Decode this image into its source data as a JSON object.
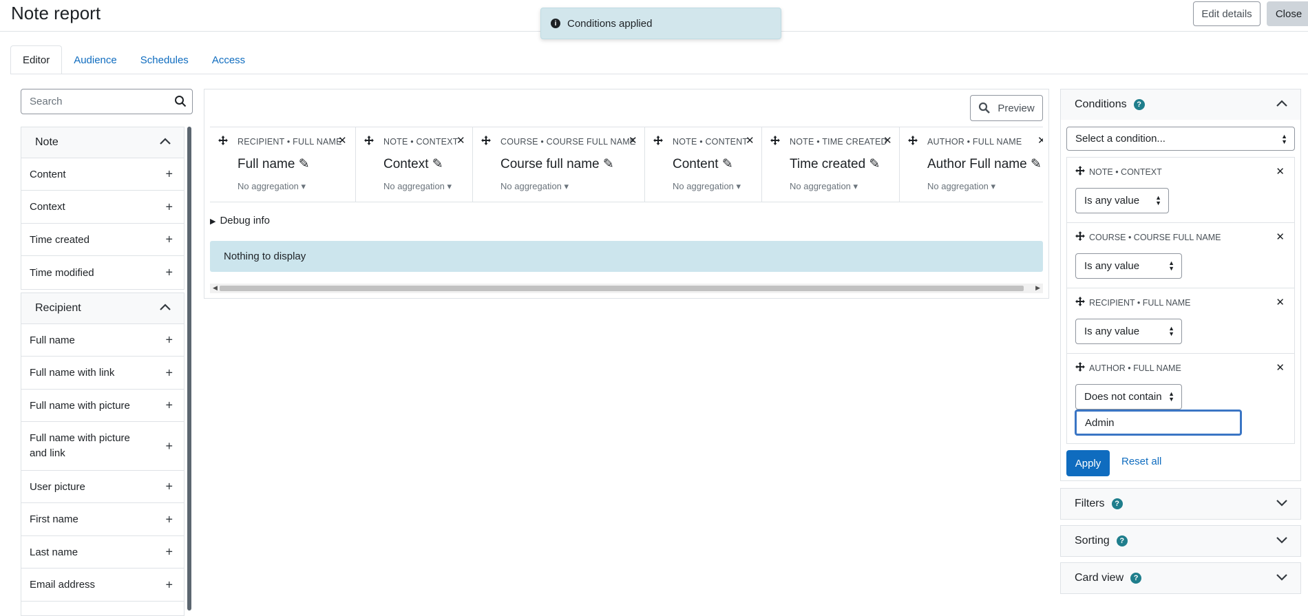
{
  "header": {
    "title": "Note report",
    "edit_details": "Edit details",
    "close": "Close"
  },
  "toast": {
    "message": "Conditions applied"
  },
  "tabs": [
    {
      "label": "Editor"
    },
    {
      "label": "Audience"
    },
    {
      "label": "Schedules"
    },
    {
      "label": "Access"
    }
  ],
  "sidebar": {
    "search_placeholder": "Search",
    "groups": [
      {
        "title": "Note",
        "items": [
          "Content",
          "Context",
          "Time created",
          "Time modified"
        ]
      },
      {
        "title": "Recipient",
        "items": [
          "Full name",
          "Full name with link",
          "Full name with picture",
          "Full name with picture and link",
          "User picture",
          "First name",
          "Last name",
          "Email address"
        ]
      }
    ]
  },
  "editor": {
    "preview_label": "Preview",
    "columns": [
      {
        "caption": "RECIPIENT • FULL NAME",
        "title": "Full name",
        "aggregation": "No aggregation"
      },
      {
        "caption": "NOTE • CONTEXT",
        "title": "Context",
        "aggregation": "No aggregation"
      },
      {
        "caption": "COURSE • COURSE FULL NAME",
        "title": "Course full name",
        "aggregation": "No aggregation"
      },
      {
        "caption": "NOTE • CONTENT",
        "title": "Content",
        "aggregation": "No aggregation"
      },
      {
        "caption": "NOTE • TIME CREATED",
        "title": "Time created",
        "aggregation": "No aggregation"
      },
      {
        "caption": "AUTHOR • FULL NAME",
        "title": "Author Full name",
        "aggregation": "No aggregation"
      }
    ],
    "debug_label": "Debug info",
    "empty_message": "Nothing to display"
  },
  "conditions_panel": {
    "title": "Conditions",
    "select_placeholder": "Select a condition...",
    "conditions": [
      {
        "caption": "NOTE • CONTEXT",
        "operator": "Is any value"
      },
      {
        "caption": "COURSE • COURSE FULL NAME",
        "operator": "Is any value"
      },
      {
        "caption": "RECIPIENT • FULL NAME",
        "operator": "Is any value"
      },
      {
        "caption": "AUTHOR • FULL NAME",
        "operator": "Does not contain",
        "value": "Admin"
      }
    ],
    "apply_label": "Apply",
    "reset_label": "Reset all"
  },
  "other_panels": [
    {
      "title": "Filters"
    },
    {
      "title": "Sorting"
    },
    {
      "title": "Card view"
    }
  ],
  "colors": {
    "link": "#0f6cbf",
    "primary": "#0f6cbf",
    "info_bg": "#cce5ed",
    "help_icon": "#1f7e8c"
  }
}
